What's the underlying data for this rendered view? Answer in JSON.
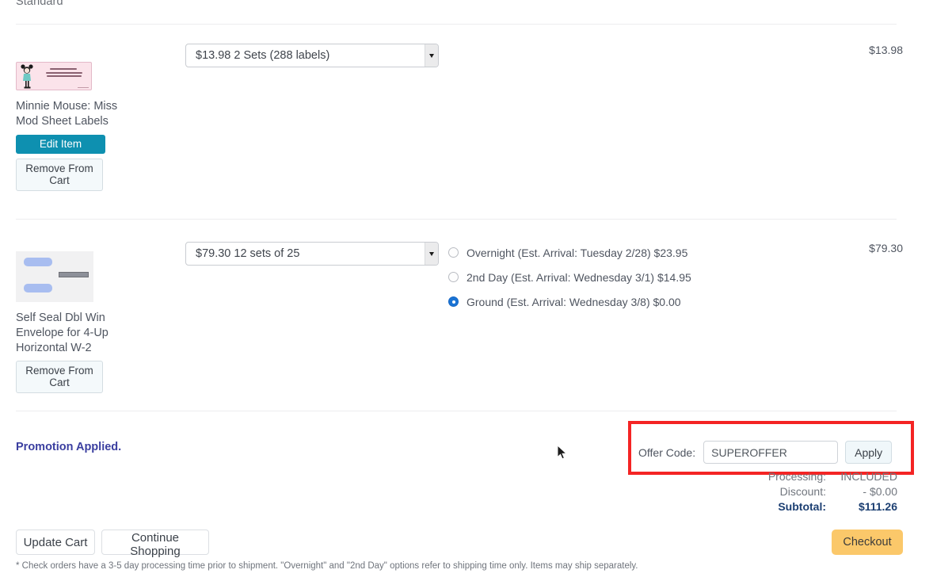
{
  "header": {
    "standard_label": "Standard"
  },
  "cart_items": [
    {
      "thumbnail_icon": "address-label-minnie-thumbnail",
      "title": "Minnie Mouse: Miss Mod Sheet Labels",
      "quantity_selected": "$13.98 2 Sets (288 labels)",
      "quantity_options": [
        "$13.98 2 Sets (288 labels)"
      ],
      "edit_label": "Edit Item",
      "remove_label": "Remove From Cart",
      "price": "$13.98",
      "shipping_options": []
    },
    {
      "thumbnail_icon": "envelope-thumbnail",
      "title": "Self Seal Dbl Win Envelope for 4-Up Horizontal W-2",
      "quantity_selected": "$79.30 12 sets of 25",
      "quantity_options": [
        "$79.30 12 sets of 25"
      ],
      "remove_label": "Remove From Cart",
      "price": "$79.30",
      "shipping_options": [
        {
          "label": "Overnight (Est. Arrival: Tuesday 2/28) $23.95",
          "selected": false
        },
        {
          "label": "2nd Day (Est. Arrival: Wednesday 3/1) $14.95",
          "selected": false
        },
        {
          "label": "Ground (Est. Arrival: Wednesday 3/8) $0.00",
          "selected": true
        }
      ]
    }
  ],
  "promotion": {
    "status_text": "Promotion Applied."
  },
  "offer_code": {
    "label": "Offer Code:",
    "value": "SUPEROFFER",
    "placeholder": "",
    "apply_label": "Apply",
    "highlight_color": "#f42424"
  },
  "totals": [
    {
      "label": "Processing:",
      "value": "INCLUDED",
      "strong": false
    },
    {
      "label": "Discount:",
      "value": "- $0.00",
      "strong": false
    },
    {
      "label": "Subtotal:",
      "value": "$111.26",
      "strong": true
    }
  ],
  "actions": {
    "update_cart": "Update Cart",
    "continue_shopping": "Continue Shopping",
    "checkout": "Checkout",
    "checkout_color": "#fbc86a"
  },
  "footnote": "* Check orders have a 3-5 day processing time prior to shipment. \"Overnight\" and \"2nd Day\" options refer to shipping time only. Items may ship separately."
}
